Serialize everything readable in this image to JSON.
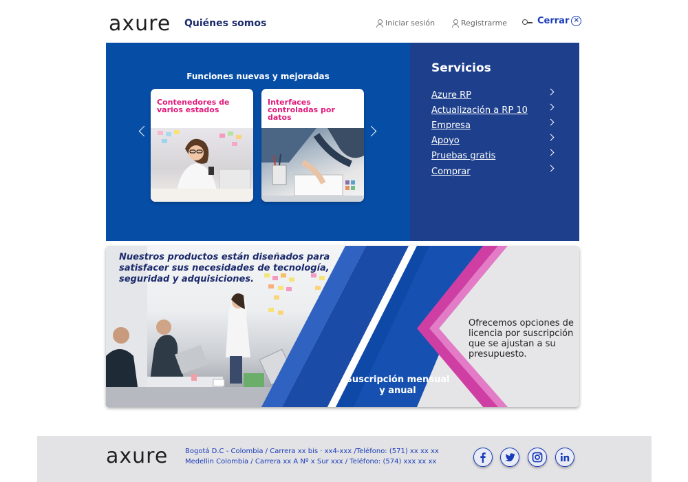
{
  "header": {
    "logo": "axure",
    "nav_title": "Quiénes somos",
    "login": "Iniciar sesión",
    "register": "Registrarme",
    "close": "Cerrar"
  },
  "hero": {
    "features_title": "Funciones nuevas y mejoradas",
    "cards": [
      {
        "title": "Contenedores de varios estados"
      },
      {
        "title": "Interfaces controladas por datos"
      }
    ]
  },
  "services": {
    "title": "Servicios",
    "items": [
      {
        "label": "Azure RP"
      },
      {
        "label": "Actualización a RP 10"
      },
      {
        "label": "Empresa "
      },
      {
        "label": "Apoyo"
      },
      {
        "label": "Pruebas gratis"
      },
      {
        "label": "Comprar"
      }
    ]
  },
  "banner": {
    "headline": "Nuestros productos están diseñados para satisfacer sus necesidades de tecnología, seguridad y adquisiciones.",
    "subscription": "Suscripción mensual y anual",
    "right_text": "Ofrecemos opciones de licencia por suscripción que se ajustan a su presupuesto."
  },
  "footer": {
    "logo": "axure",
    "line1": "Bogotá D.C - Colombia / Carrera xx bis · xx4-xxx /Teléfono: (571) xx xx xx",
    "line2": "Medellin Colombia / Carrera xx A Nº x  Sur xxx / Teléfono: (574) xxx xx xx",
    "social": [
      "facebook-icon",
      "twitter-icon",
      "instagram-icon",
      "linkedin-icon"
    ]
  },
  "colors": {
    "hero_blue": "#064da6",
    "services_blue": "#1d3f8c",
    "accent_pink": "#e0197a",
    "link_blue": "#1a3cb8",
    "dark_navy": "#1b2a6b"
  }
}
